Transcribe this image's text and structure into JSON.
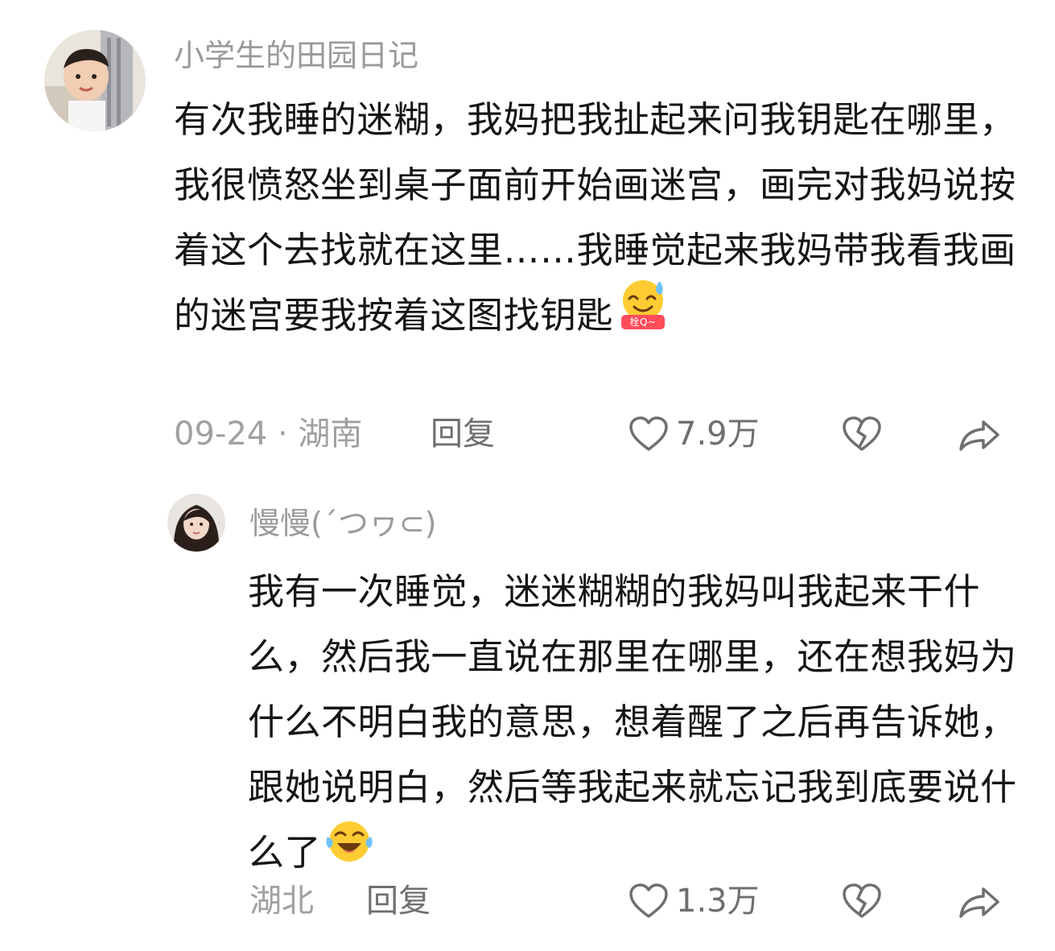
{
  "comments": [
    {
      "username": "小学生的田园日记",
      "text": "有次我睡的迷糊，我妈把我扯起来问我钥匙在哪里，我很愤怒坐到桌子面前开始画迷宫，画完对我妈说按着这个去找就在这里……我睡觉起来我妈带我看我画的迷宫要我按着这图找钥匙",
      "emoji_badge": "栓Q~",
      "meta": "09-24 · 湖南",
      "reply_label": "回复",
      "likes": "7.9万"
    },
    {
      "username": "慢慢(´つヮ⊂)",
      "text": "我有一次睡觉，迷迷糊糊的我妈叫我起来干什么，然后我一直说在那里在哪里，还在想我妈为什么不明白我的意思，想着醒了之后再告诉她，跟她说明白，然后等我起来就忘记我到底要说什么了",
      "meta": "湖北",
      "reply_label": "回复",
      "likes": "1.3万"
    }
  ],
  "icons": {
    "like": "heart-outline-icon",
    "dislike": "broken-heart-icon",
    "share": "share-arrow-icon",
    "emoji1": "sweat-smile-emoji-icon",
    "emoji2": "laughing-tears-emoji-icon"
  },
  "colors": {
    "text": "#151515",
    "secondary": "#9a9a9a",
    "action": "#6f6f6f"
  }
}
